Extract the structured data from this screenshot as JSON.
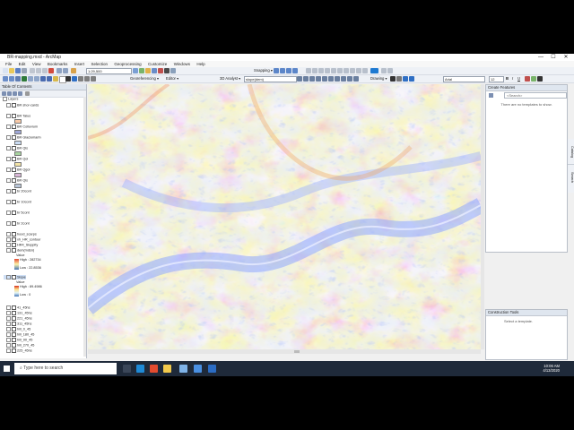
{
  "window": {
    "title": "BR-mapping.mxd - ArcMap",
    "controls": [
      "—",
      "☐",
      "✕"
    ]
  },
  "menu": [
    "File",
    "Edit",
    "View",
    "Bookmarks",
    "Insert",
    "Selection",
    "Geoprocessing",
    "Customize",
    "Windows",
    "Help"
  ],
  "toolbar": {
    "scale_value": "1:29,500",
    "georef_label": "Georeferencing ▾",
    "editor_label": "Editor ▾",
    "analyst_label": "3D Analyst ▾",
    "analyst_layer": "slope(dem)",
    "snapping_label": "Snapping ▾",
    "drawing_label": "Drawing ▾",
    "font_value": "Arial",
    "font_size": "12"
  },
  "toc": {
    "title": "Table Of Contents",
    "layers": [
      {
        "label": "Layers"
      },
      {
        "label": "BR shor-cards"
      },
      {
        "label": "BR Talus"
      },
      {
        "label": "BR Colluvium"
      },
      {
        "label": "BR Glaciomarin"
      },
      {
        "label": "BR Qls"
      },
      {
        "label": "BR Qol"
      },
      {
        "label": "BR Qgol"
      },
      {
        "label": "BR Qls"
      },
      {
        "label": "br 20cont"
      },
      {
        "label": "br 10cont"
      },
      {
        "label": "br 5cont"
      },
      {
        "label": "br 2cont"
      },
      {
        "label": "hood_scarps"
      },
      {
        "label": "xh_HR_contour"
      },
      {
        "label": "HR4_Sloppity"
      },
      {
        "label": "dem(mdsn)"
      },
      {
        "label": "Value"
      },
      {
        "label": "High : 282734"
      },
      {
        "label": "Low : 22.8536"
      },
      {
        "label": "Slope"
      },
      {
        "label": "Value"
      },
      {
        "label": "High : 89.4986"
      },
      {
        "label": "Low : 0"
      },
      {
        "label": "41_45hs"
      },
      {
        "label": "131_45hs"
      },
      {
        "label": "221_45hs"
      },
      {
        "label": "311_45hs"
      },
      {
        "label": "hill_0_45"
      },
      {
        "label": "hill_180_45"
      },
      {
        "label": "hill_90_45"
      },
      {
        "label": "hill_270_45"
      },
      {
        "label": "225_45hs"
      }
    ]
  },
  "catalog": {
    "title": "Create Features",
    "search_placeholder": "<Search>",
    "empty_message": "There are no templates to show."
  },
  "construction": {
    "title": "Construction Tools",
    "message": "Select a template."
  },
  "side_tabs": [
    "Catalog",
    "Search"
  ],
  "taskbar": {
    "search_placeholder": "Type here to search",
    "time": "10:06 AM",
    "date": "4/13/2020"
  },
  "colors": {
    "titlebar": "#ffffff",
    "taskbar": "#1f2a3a",
    "panel_header": "#dfe6ef"
  }
}
